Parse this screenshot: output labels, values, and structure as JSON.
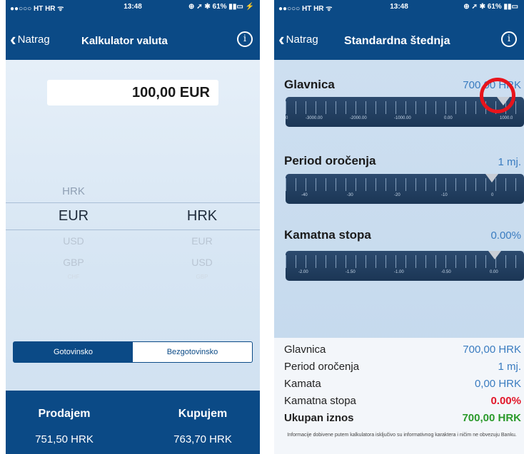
{
  "left": {
    "status": {
      "carrier": "●●○○○ HT HR ᯤ",
      "time": "13:48",
      "battery": "⊕ ➚ ✱ 61% ▮▮▭ ⚡"
    },
    "nav": {
      "back_label": "Natrag",
      "title": "Kalkulator valuta",
      "info": "i"
    },
    "amount": "100,00 EUR",
    "picker_from": [
      "HRK",
      "EUR",
      "USD",
      "GBP",
      "CHF"
    ],
    "picker_to": [
      "HRK",
      "EUR",
      "USD",
      "GBP"
    ],
    "segment": {
      "options": [
        "Gotovinsko",
        "Bezgotovinsko"
      ],
      "selected": "Gotovinsko"
    },
    "bottom": {
      "sell_label": "Prodajem",
      "sell_value": "751,50 HRK",
      "buy_label": "Kupujem",
      "buy_value": "763,70 HRK"
    }
  },
  "right": {
    "status": {
      "carrier": "●●○○○ HT HR ᯤ",
      "time": "13:48",
      "battery": "⊕ ➚ ✱ 61% ▮▮▭"
    },
    "nav": {
      "back_label": "Natrag",
      "title": "Standardna štednja",
      "info": "i"
    },
    "sliders": [
      {
        "label": "Glavnica",
        "value": "700,00 HRK",
        "ticks": [
          "0",
          "-3000.00",
          "-2000.00",
          "-1000.00",
          "0.00",
          "1000.0"
        ]
      },
      {
        "label": "Period oročenja",
        "value": "1 mj.",
        "ticks": [
          "-40",
          "-30",
          "-20",
          "-10",
          "0"
        ]
      },
      {
        "label": "Kamatna stopa",
        "value": "0.00%",
        "ticks": [
          "-2.00",
          "-1.50",
          "-1.00",
          "-0.50",
          "0.00"
        ]
      }
    ],
    "summary": [
      {
        "key": "Glavnica",
        "value": "700,00 HRK"
      },
      {
        "key": "Period oročenja",
        "value": "1 mj."
      },
      {
        "key": "Kamata",
        "value": "0,00 HRK"
      },
      {
        "key": "Kamatna stopa",
        "value": "0.00%"
      },
      {
        "key": "Ukupan iznos",
        "value": "700,00 HRK"
      }
    ],
    "disclaimer": "Informacije dobivene putem kalkulatora isključivo su informativnog karaktera i ničim ne obvezuju Banku."
  },
  "colors": {
    "nav": "#0b4a86",
    "value_blue": "#3a7cc0",
    "rate_red": "#e2172a",
    "total_green": "#2b9a2b",
    "highlight_ring": "#e8141b"
  }
}
